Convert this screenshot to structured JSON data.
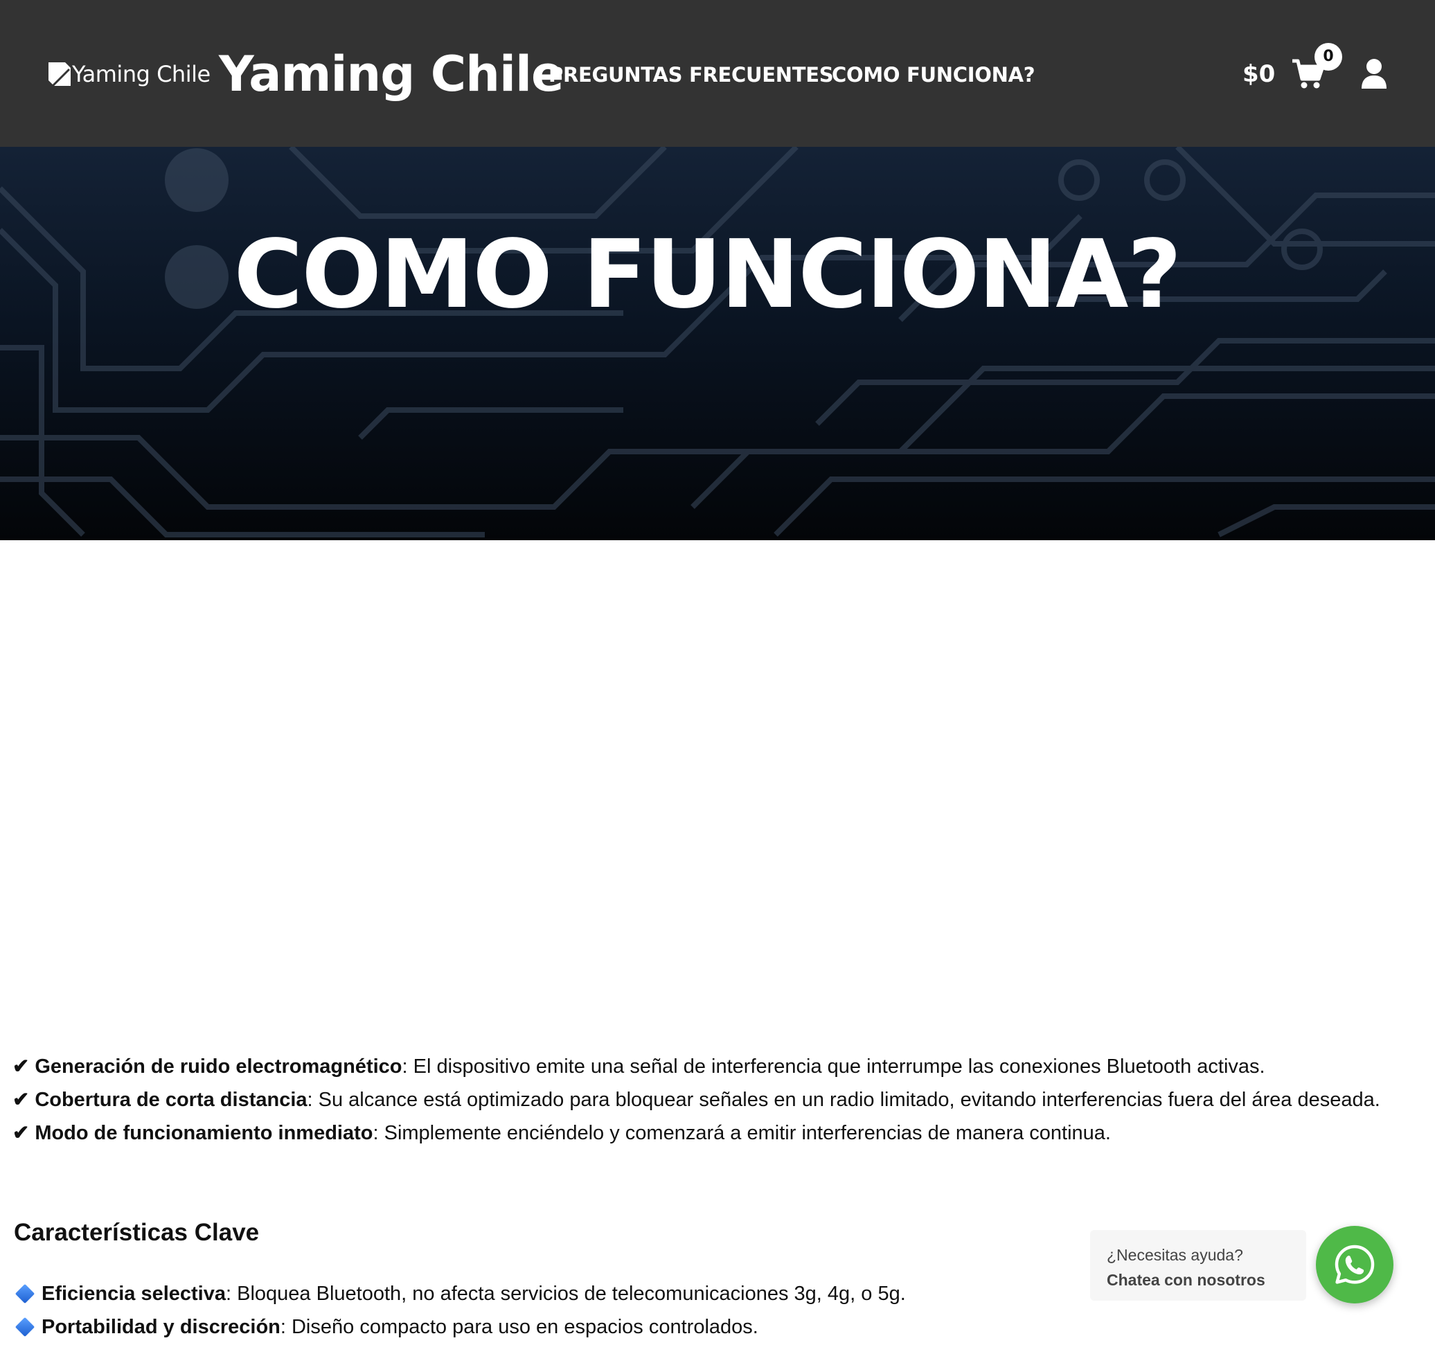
{
  "header": {
    "logo_alt": "Yaming Chile",
    "site_title": "Yaming Chile",
    "nav": [
      {
        "label": "PREGUNTAS FRECUENTES"
      },
      {
        "label": "COMO FUNCIONA?"
      }
    ],
    "cart_total": "$0",
    "cart_count": "0",
    "icons": {
      "cart": "cart-icon",
      "user": "user-icon"
    }
  },
  "hero": {
    "title": "COMO FUNCIONA?"
  },
  "features": [
    {
      "check": "✔",
      "bold": "Generación de ruido electromagnético",
      "text": ": El dispositivo emite una señal de interferencia que interrumpe las conexiones Bluetooth activas."
    },
    {
      "check": "✔",
      "bold": "Cobertura de corta distancia",
      "text": ": Su alcance está optimizado para bloquear señales en un radio limitado, evitando interferencias fuera del área deseada."
    },
    {
      "check": "✔",
      "bold": "Modo de funcionamiento inmediato",
      "text": ": Simplemente enciéndelo y comenzará a emitir interferencias de manera continua."
    }
  ],
  "key_section": {
    "title": "Características Clave",
    "items": [
      {
        "bold": "Eficiencia selectiva",
        "text": ": Bloquea Bluetooth, no afecta servicios de telecomunicaciones 3g, 4g, o 5g."
      },
      {
        "bold": "Portabilidad y discreción",
        "text": ": Diseño compacto para uso en espacios controlados."
      }
    ]
  },
  "chat": {
    "line1": "¿Necesitas ayuda?",
    "line2": "Chatea con nosotros",
    "color": "#4fb948",
    "icon": "whatsapp-icon"
  },
  "colors": {
    "header_bg": "#333333",
    "hero_bg": "#0a1422"
  }
}
